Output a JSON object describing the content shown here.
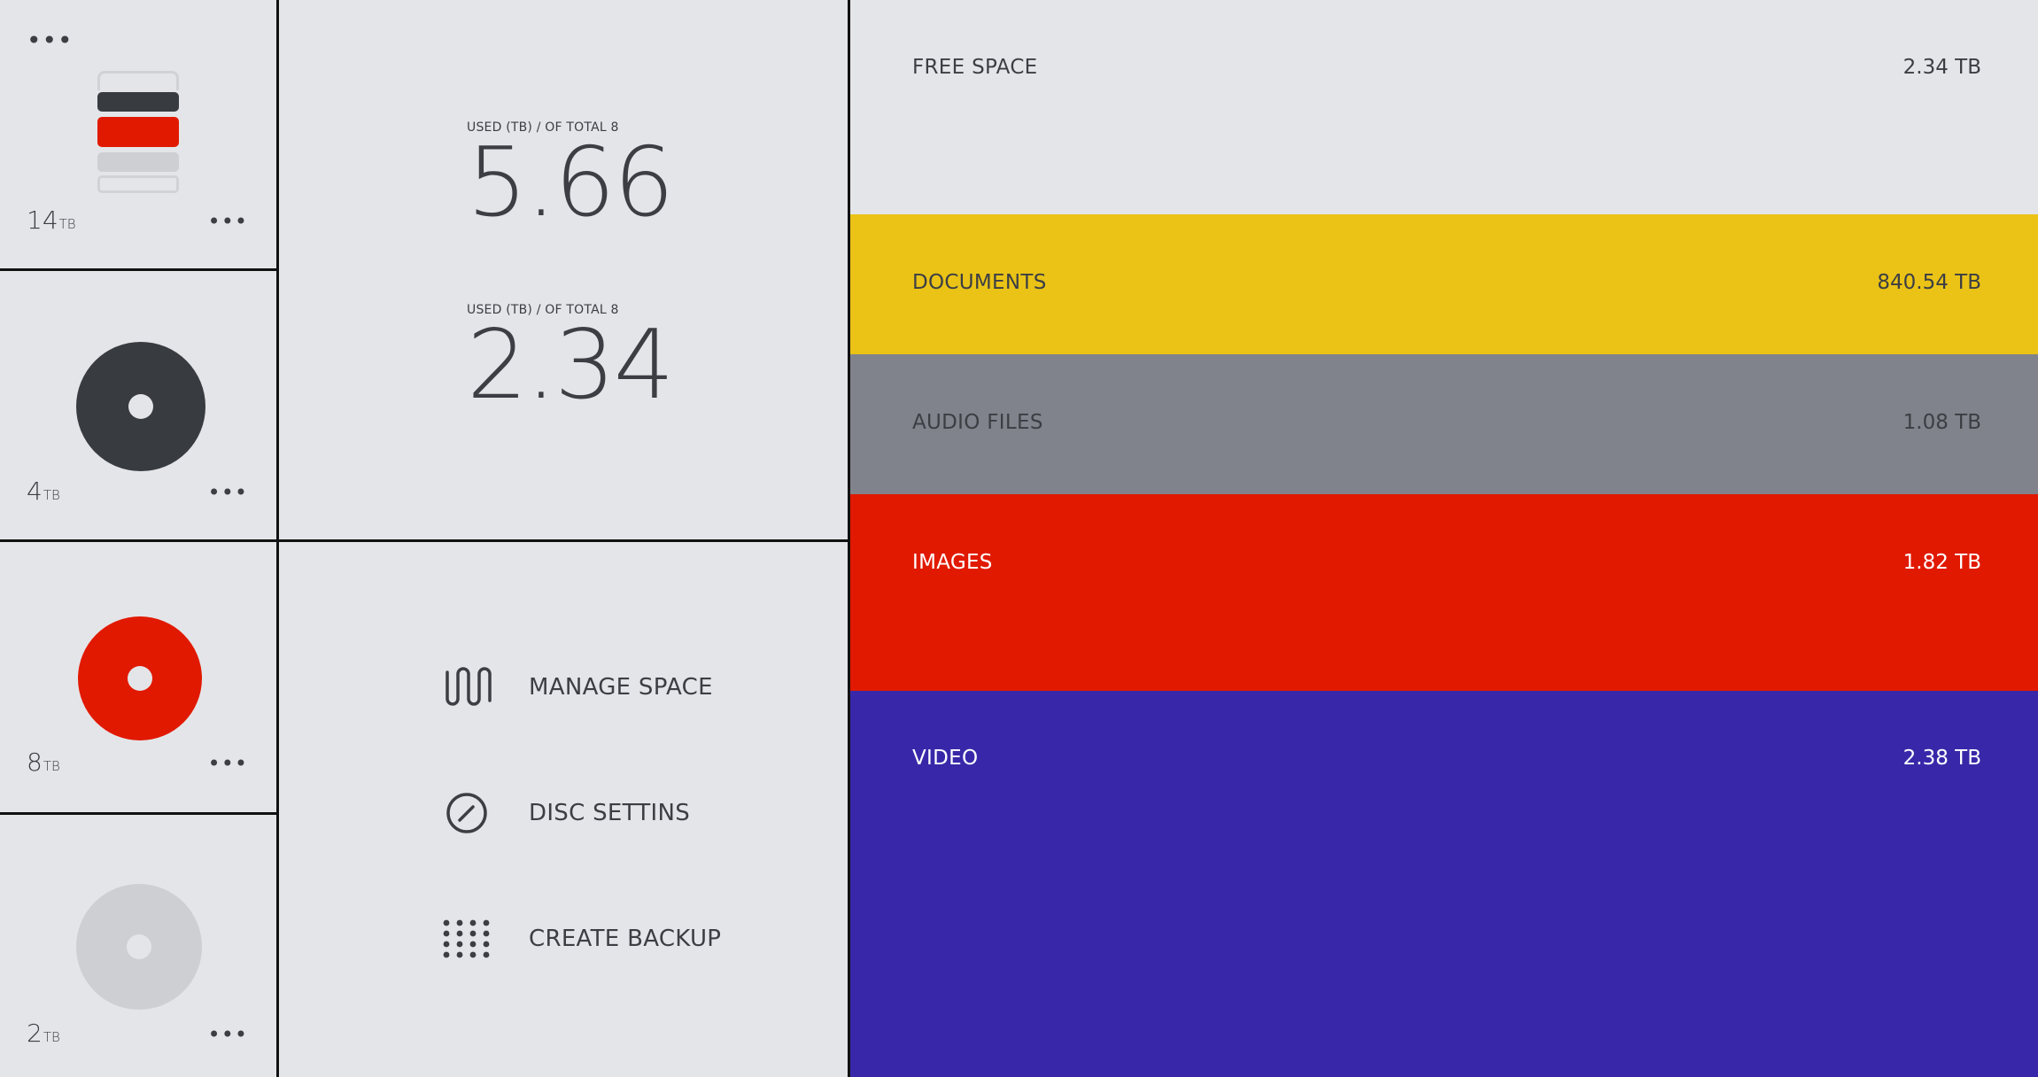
{
  "drives": [
    {
      "capacity": "14",
      "unit": "TB",
      "icon": "drive-stack-icon"
    },
    {
      "capacity": "4",
      "unit": "TB",
      "icon": "disc-icon",
      "color": "#383b40"
    },
    {
      "capacity": "8",
      "unit": "TB",
      "icon": "disc-icon",
      "color": "#e11900"
    },
    {
      "capacity": "2",
      "unit": "TB",
      "icon": "disc-icon",
      "color": "#cdcfd2"
    }
  ],
  "menu_dots": "•••",
  "stats": [
    {
      "label": "USED (TB) / OF TOTAL 8",
      "value": "5.66"
    },
    {
      "label": "USED (TB) / OF TOTAL 8",
      "value": "2.34"
    }
  ],
  "actions": [
    {
      "label": "MANAGE SPACE",
      "icon": "wave-icon"
    },
    {
      "label": "DISC SETTINS",
      "icon": "gauge-icon"
    },
    {
      "label": "CREATE BACKUP",
      "icon": "grid-dots-icon"
    }
  ],
  "categories": [
    {
      "name": "FREE SPACE",
      "size": "2.34 TB",
      "bg": "#e4e5e8",
      "fg": "#3c3e44"
    },
    {
      "name": "DOCUMENTS",
      "size": "840.54 TB",
      "bg": "#eac316",
      "fg": "#3c3e44"
    },
    {
      "name": "AUDIO FILES",
      "size": "1.08 TB",
      "bg": "#80838b",
      "fg": "#3c3e44"
    },
    {
      "name": "IMAGES",
      "size": "1.82 TB",
      "bg": "#e11900",
      "fg": "#ffffff"
    },
    {
      "name": "VIDEO",
      "size": "2.38 TB",
      "bg": "#3828a9",
      "fg": "#ffffff"
    }
  ]
}
